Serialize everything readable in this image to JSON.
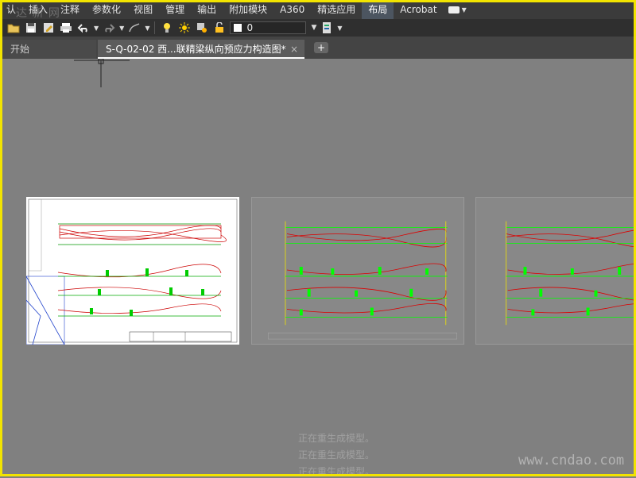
{
  "menu": {
    "items": [
      {
        "label": "认",
        "active": false
      },
      {
        "label": "插入",
        "active": false
      },
      {
        "label": "注释",
        "active": false
      },
      {
        "label": "参数化",
        "active": false
      },
      {
        "label": "视图",
        "active": false
      },
      {
        "label": "管理",
        "active": false
      },
      {
        "label": "输出",
        "active": false
      },
      {
        "label": "附加模块",
        "active": false
      },
      {
        "label": "A360",
        "active": false
      },
      {
        "label": "精选应用",
        "active": false
      },
      {
        "label": "布局",
        "active": true
      },
      {
        "label": "Acrobat",
        "active": false
      }
    ]
  },
  "toolbar": {
    "current_layer": "0"
  },
  "tabs": {
    "start_label": "开始",
    "doc_label": "S-Q-02-02 西...联精梁纵向预应力构造图*",
    "close_glyph": "×",
    "add_glyph": "+"
  },
  "status": {
    "lines": [
      "正在重生成模型。",
      "正在重生成模型。",
      "正在重生成模型。"
    ]
  },
  "watermarks": {
    "top_left": "达  新  网",
    "bottom_right": "www.cndao.com"
  },
  "colors": {
    "accent_yellow": "#f2e400",
    "canvas": "#808080",
    "beam_red": "#cc0000",
    "dim_green": "#00ff00"
  }
}
